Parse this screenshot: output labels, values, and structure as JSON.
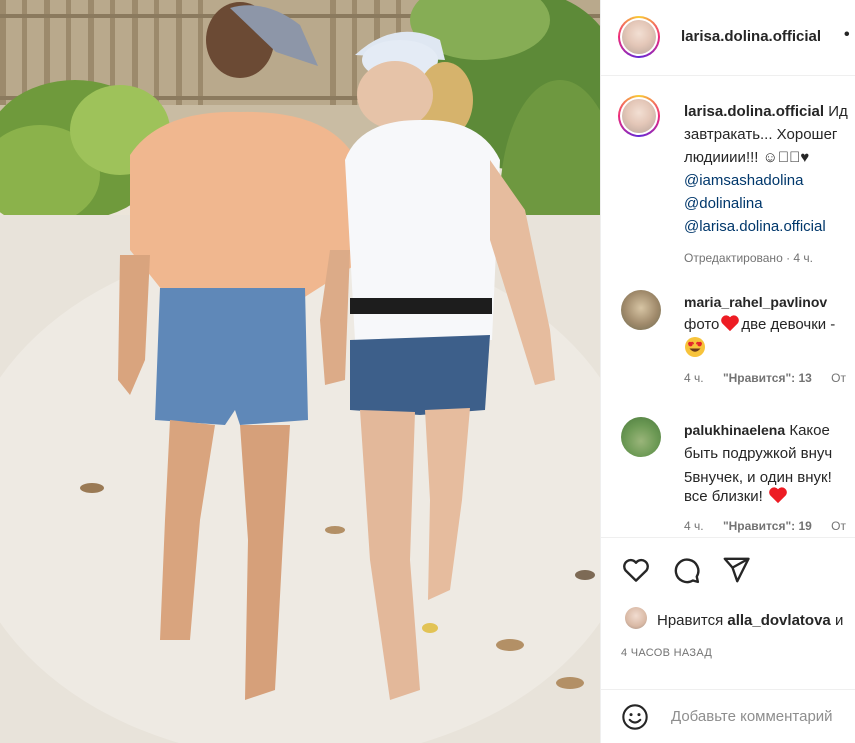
{
  "post": {
    "author": "larisa.dolina.official",
    "more_glyph": "•",
    "caption": {
      "username": "larisa.dolina.official",
      "text_line1": "Ид",
      "text_line2": "завтракать... Хорошег",
      "text_line3": "людииии!!! ☺🏻🏻♥",
      "mentions": [
        "@iamsashadolina",
        "@dolinalina",
        "@larisa.dolina.official"
      ],
      "meta": "Отредактировано · 4 ч."
    },
    "comments": [
      {
        "username": "maria_rahel_pavlinov",
        "text_line1": "фото",
        "text_line2": "две девочки -",
        "time": "4 ч.",
        "likes": "\"Нравится\": 13",
        "reply": "От"
      },
      {
        "username": "palukhinaelena",
        "text_line0": "Какое",
        "text_line1": "быть подружкой внуч",
        "text_line2": "5внучек, и один внук!",
        "text_line3": "все близки!",
        "time": "4 ч.",
        "likes": "\"Нравится\": 19",
        "reply": "От"
      }
    ],
    "liked_by_prefix": "Нравится",
    "liked_by_user": "alla_dovlatova",
    "liked_by_suffix": "и",
    "timestamp": "4 ЧАСОВ НАЗАД",
    "add_comment_placeholder": "Добавьте комментарий"
  },
  "icons": [
    "heart-icon",
    "comment-icon",
    "share-icon",
    "emoji-icon"
  ],
  "colors": {
    "mention": "#00376b",
    "meta": "#737373",
    "heart_red": "#ed1c24"
  }
}
